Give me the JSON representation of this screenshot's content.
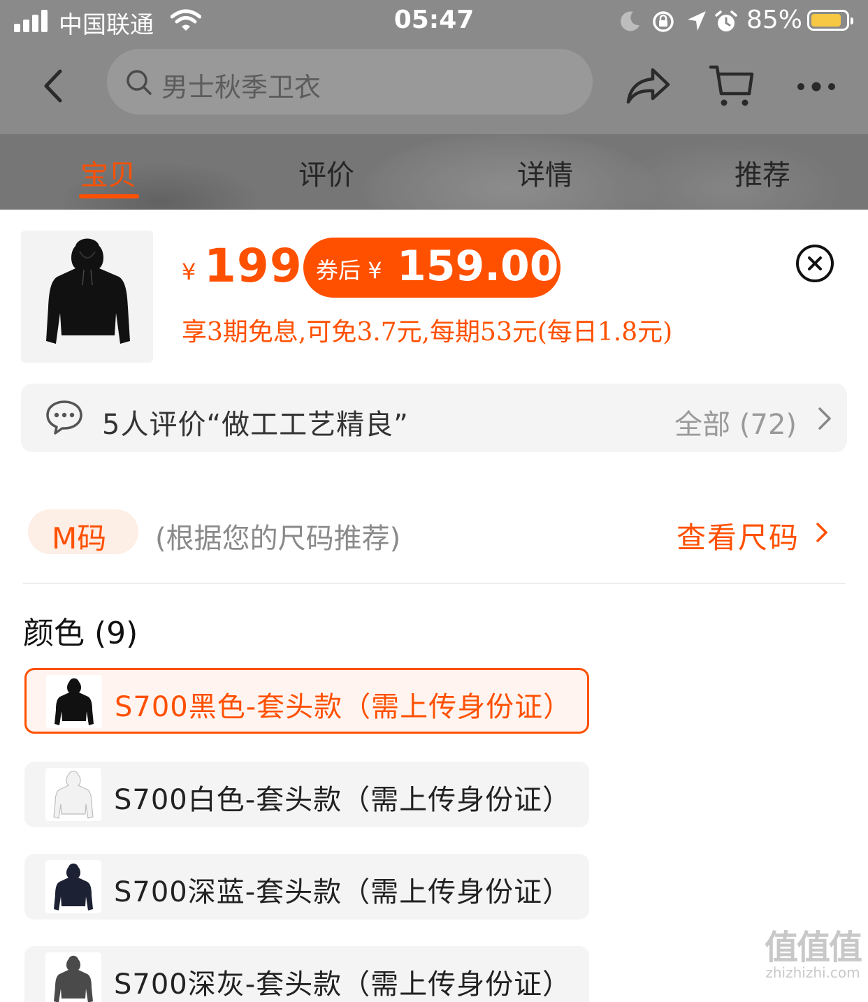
{
  "status_bar": {
    "carrier": "中国联通",
    "time": "05:47",
    "battery_percent": "85%",
    "battery_level": 0.85,
    "battery_color": "#f7c843"
  },
  "header": {
    "search_placeholder": "男士秋季卫衣",
    "icons": [
      "back-icon",
      "search-icon",
      "share-icon",
      "cart-icon",
      "more-icon"
    ]
  },
  "tabs": [
    {
      "label": "宝贝",
      "active": true
    },
    {
      "label": "评价",
      "active": false
    },
    {
      "label": "详情",
      "active": false
    },
    {
      "label": "推荐",
      "active": false
    }
  ],
  "sku_panel": {
    "price_symbol": "¥",
    "price": "199",
    "coupon_label": "券后",
    "coupon_symbol": "¥",
    "coupon_price": "159.00",
    "installment_text": "享3期免息,可免3.7元,每期53元(每日1.8元)",
    "accent_color": "#ff5000"
  },
  "review_summary": {
    "text": "5人评价“做工工艺精良”",
    "all_label": "全部 (72)"
  },
  "size_recommendation": {
    "size": "M码",
    "note": "(根据您的尺码推荐)",
    "link": "查看尺码"
  },
  "color_section": {
    "title": "颜色 (9)",
    "options": [
      {
        "label": "S700黑色-套头款（需上传身份证）",
        "selected": true,
        "swatch": "#111111"
      },
      {
        "label": "S700白色-套头款（需上传身份证）",
        "selected": false,
        "swatch": "#f2f2f2"
      },
      {
        "label": "S700深蓝-套头款（需上传身份证）",
        "selected": false,
        "swatch": "#1c2133"
      },
      {
        "label": "S700深灰-套头款（需上传身份证）",
        "selected": false,
        "swatch": "#4a4a4a"
      }
    ]
  },
  "watermark": {
    "text": "值值值",
    "url": "zhizhizhi.com"
  }
}
